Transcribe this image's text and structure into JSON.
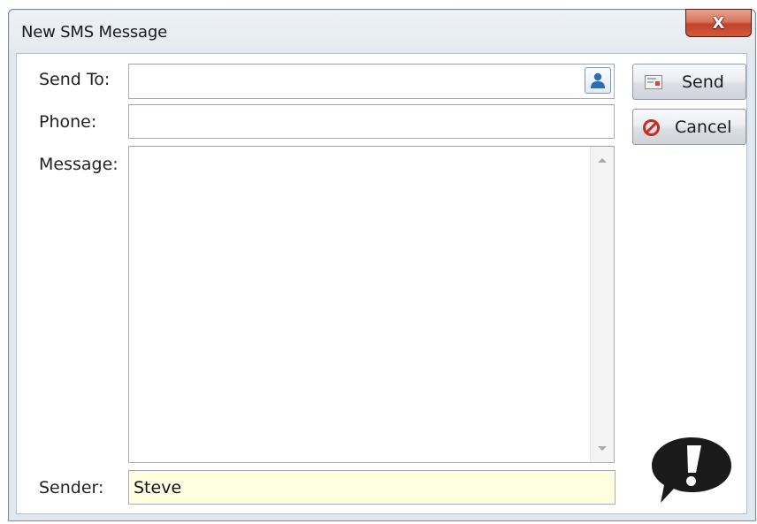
{
  "window": {
    "title": "New SMS Message",
    "close_glyph": "X"
  },
  "form": {
    "send_to_label": "Send To:",
    "send_to_value": "",
    "phone_label": "Phone:",
    "phone_value": "",
    "message_label": "Message:",
    "message_value": "",
    "sender_label": "Sender:",
    "sender_value": "Steve"
  },
  "buttons": {
    "send_label": "Send",
    "cancel_label": "Cancel"
  },
  "icons": {
    "contact_picker": "contact-person-icon",
    "send": "send-message-icon",
    "cancel": "prohibited-circle-icon",
    "alert": "exclamation-speech-bubble-icon"
  },
  "colors": {
    "sender_field_bg": "#ffffe1",
    "close_button": "#c4412a",
    "cancel_icon": "#d0281c",
    "contact_icon": "#2f6db3"
  }
}
